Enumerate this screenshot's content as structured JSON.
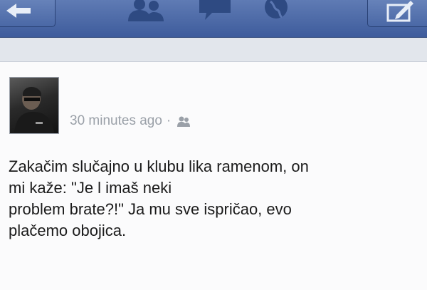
{
  "post": {
    "timestamp": "30 minutes ago",
    "separator": "·",
    "privacy_icon": "friends-audience-icon",
    "lines": [
      "Zakačim slučajno u klubu lika ramenom, on",
      "mi kaže: \"Je l imaš neki",
      "problem brate?!\" Ja mu sve ispričao, evo",
      "plačemo obojica."
    ]
  },
  "topbar": {
    "icons": [
      "back-arrow-icon",
      "friend-requests-icon",
      "messages-icon",
      "notifications-globe-icon",
      "compose-icon"
    ],
    "background_color": "#3e5c9c"
  }
}
